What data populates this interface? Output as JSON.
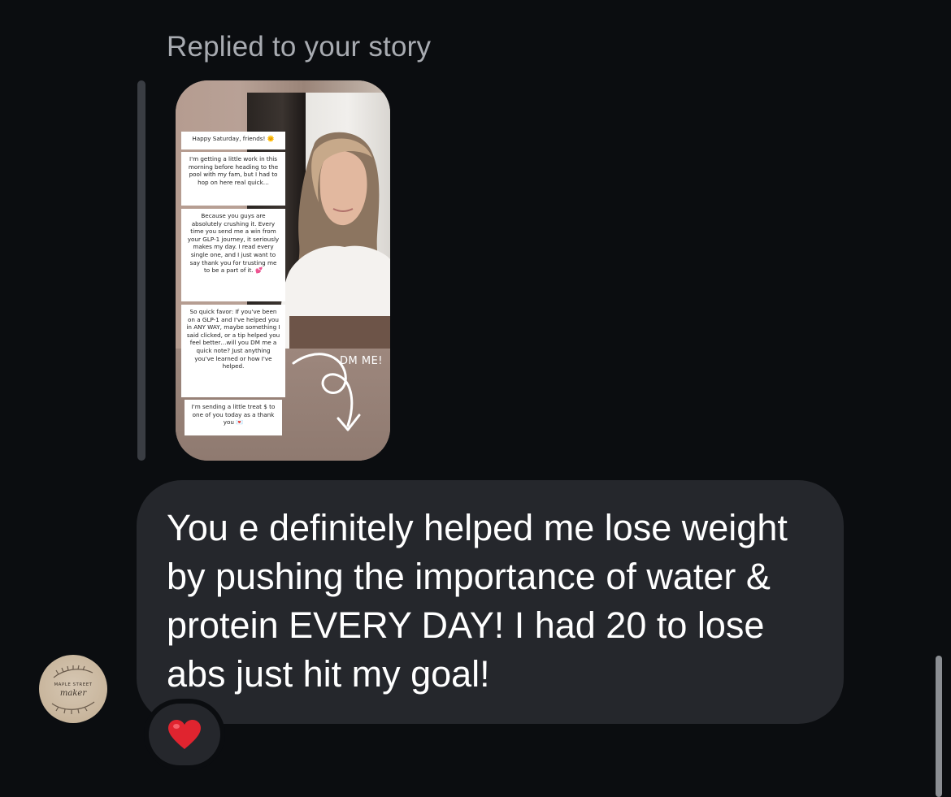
{
  "thread": {
    "replied_label": "Replied to your story"
  },
  "story": {
    "text_blocks": [
      "Happy Saturday, friends! 🌞",
      "I'm getting a little work in this morning before heading to the pool with my fam, but I had to hop on here real quick…",
      "Because you guys are absolutely crushing it. Every time you send me a win from your GLP-1 journey, it seriously makes my day. I read every single one, and I just want to say thank you for trusting me to be a part of it. 💕",
      "So quick favor: If you've been on a GLP-1 and I've helped you in ANY WAY, maybe something I said clicked, or a tip helped you feel better…will you DM me a quick note? Just anything you've learned or how I've helped.",
      "I'm sending a little treat $ to one of you today as a thank you 💌"
    ],
    "sticker_text": "DM ME!"
  },
  "message": {
    "text": "You e definitely helped me lose weight by pushing the importance of water & protein EVERY DAY! I had 20 to lose abs just hit my goal!",
    "reaction_emoji": "❤️"
  },
  "avatar": {
    "logo_top": "MAPLE STREET",
    "logo_script": "maker"
  },
  "colors": {
    "background": "#0b0d10",
    "bubble": "#25272c",
    "label": "#a8abb1",
    "heart": "#e0242f"
  }
}
